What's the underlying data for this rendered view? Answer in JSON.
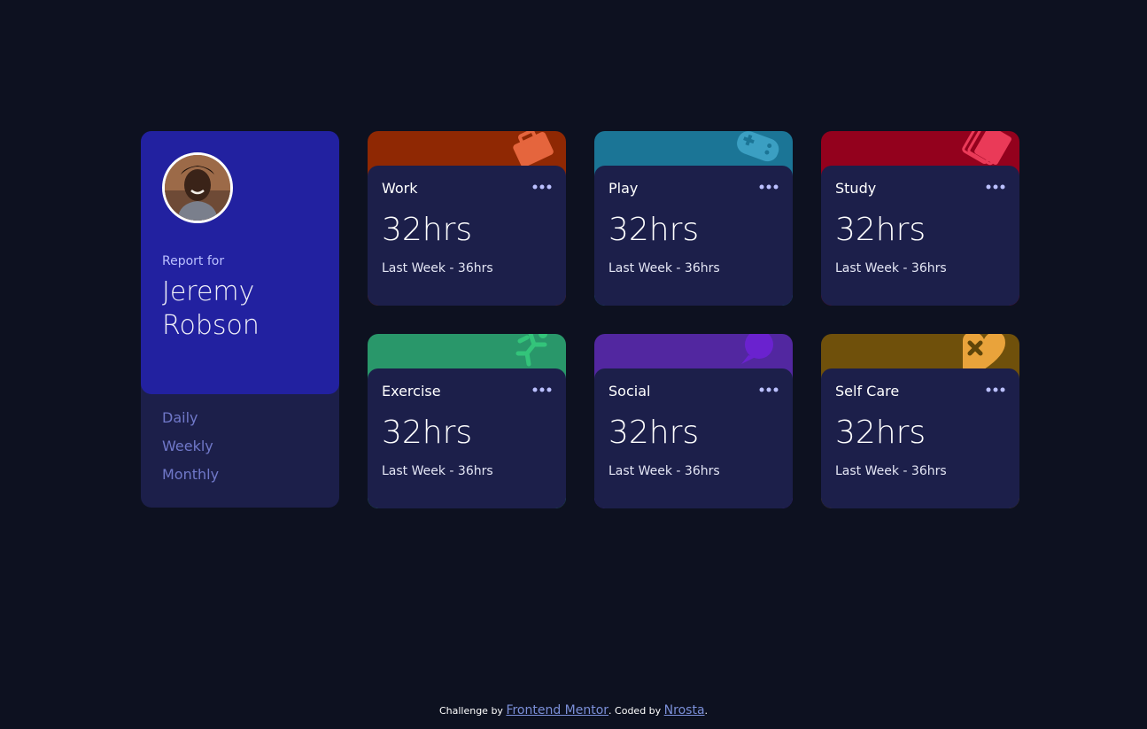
{
  "profile": {
    "report_label": "Report for",
    "name": "Jeremy Robson",
    "avatar_icon": "avatar-photo"
  },
  "periods": [
    "Daily",
    "Weekly",
    "Monthly"
  ],
  "activities": [
    {
      "title": "Work",
      "current": "32hrs",
      "previous": "Last Week - 36hrs",
      "color": "#ff8b64",
      "icon": "briefcase-icon"
    },
    {
      "title": "Play",
      "current": "32hrs",
      "previous": "Last Week - 36hrs",
      "color": "#55c2e6",
      "icon": "gamepad-icon"
    },
    {
      "title": "Study",
      "current": "32hrs",
      "previous": "Last Week - 36hrs",
      "color": "#ff5e7d",
      "icon": "books-icon"
    },
    {
      "title": "Exercise",
      "current": "32hrs",
      "previous": "Last Week - 36hrs",
      "color": "#4bcf82",
      "icon": "runner-icon"
    },
    {
      "title": "Social",
      "current": "32hrs",
      "previous": "Last Week - 36hrs",
      "color": "#7335d2",
      "icon": "chat-icon"
    },
    {
      "title": "Self Care",
      "current": "32hrs",
      "previous": "Last Week - 36hrs",
      "color": "#f1c75b",
      "icon": "heart-bandage-icon"
    }
  ],
  "footer": {
    "challenge_prefix": "Challenge by",
    "challenge_link": "Frontend Mentor",
    "coded_prefix": ". Coded by",
    "coded_link": "Nrosta",
    "suffix": "."
  }
}
